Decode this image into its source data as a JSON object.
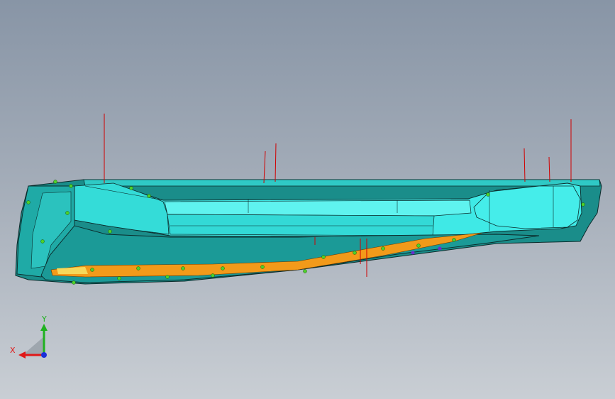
{
  "viewport": {
    "background_top": "#8895a6",
    "background_bottom": "#c9ced4"
  },
  "model": {
    "body_color": "#3fe9e6",
    "body_shade": "#25b8b6",
    "edge_color": "#0b2b2b",
    "inner_strip_color": "#f29a1a",
    "inner_strip_light": "#f7d85a",
    "annotation_line_color": "#d00000",
    "marker_color": "#4ed02a",
    "marker_alt_color": "#6a2bd0"
  },
  "triad": {
    "x_label": "X",
    "y_label": "Y",
    "x_color": "#e01818",
    "y_color": "#1fb21f",
    "z_color": "#1a2fd8"
  }
}
